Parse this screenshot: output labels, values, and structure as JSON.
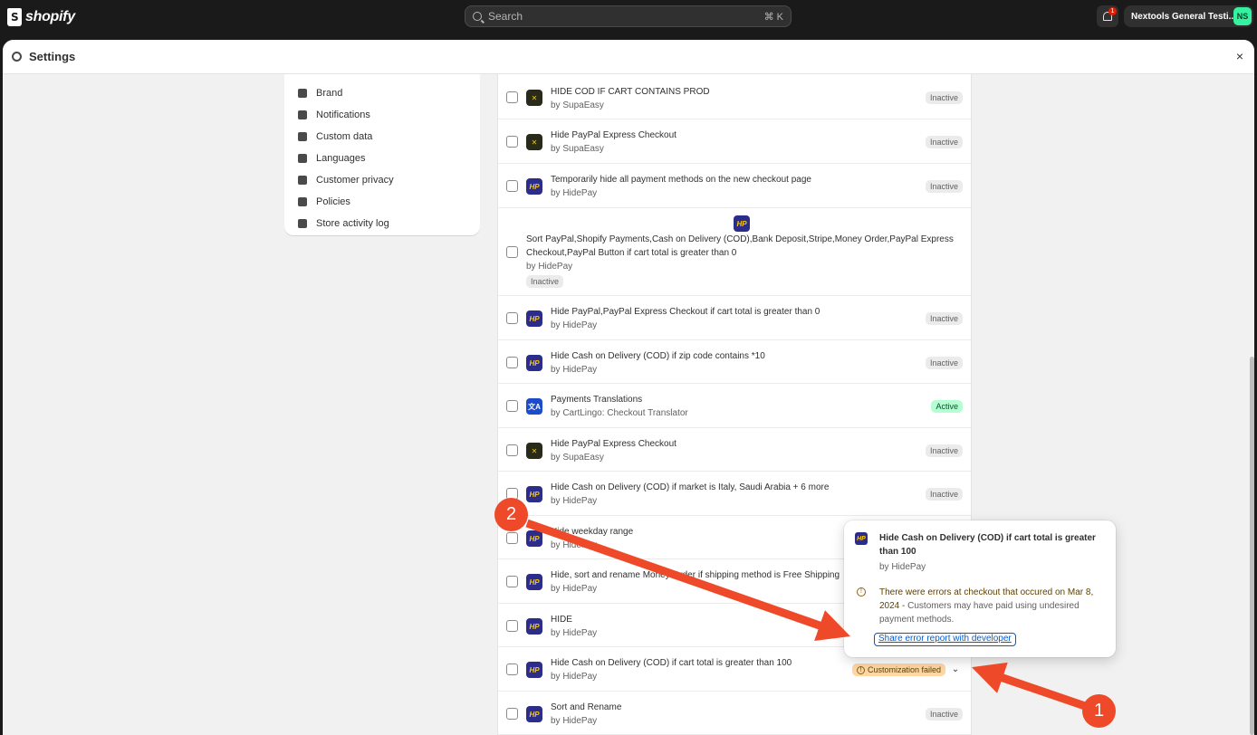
{
  "topbar": {
    "logo_text": "shopify",
    "search_placeholder": "Search",
    "search_shortcut": "⌘ K",
    "notification_count": "1",
    "store_name": "Nextools General Testi...",
    "avatar_initials": "NS"
  },
  "modal": {
    "title": "Settings",
    "close_glyph": "×"
  },
  "sidebar": {
    "items": [
      {
        "label": "Brand",
        "icon": "brand-icon"
      },
      {
        "label": "Notifications",
        "icon": "bell-icon"
      },
      {
        "label": "Custom data",
        "icon": "custom-data-icon"
      },
      {
        "label": "Languages",
        "icon": "language-icon"
      },
      {
        "label": "Customer privacy",
        "icon": "lock-icon"
      },
      {
        "label": "Policies",
        "icon": "policies-icon"
      },
      {
        "label": "Store activity log",
        "icon": "activity-log-icon"
      }
    ]
  },
  "rows": [
    {
      "title": "HIDE COD IF CART CONTAINS PROD",
      "by": "by SupaEasy",
      "icon": "supaeasy",
      "status": "Inactive"
    },
    {
      "title": "Hide PayPal Express Checkout",
      "by": "by SupaEasy",
      "icon": "supaeasy",
      "status": "Inactive"
    },
    {
      "title": "Temporarily hide all payment methods on the new checkout page",
      "by": "by HidePay",
      "icon": "hidepay",
      "status": "Inactive"
    },
    {
      "title_line1": "Sort PayPal,Shopify Payments,Cash on Delivery (COD),Bank Deposit,Stripe,Money Order,PayPal Express",
      "title_line2": "Checkout,PayPal Button if cart total is greater than 0",
      "by": "by HidePay",
      "icon": "hidepay",
      "status": "Inactive"
    },
    {
      "title": "Hide PayPal,PayPal Express Checkout if cart total is greater than 0",
      "by": "by HidePay",
      "icon": "hidepay",
      "status": "Inactive"
    },
    {
      "title": "Hide Cash on Delivery (COD) if zip code contains *10",
      "by": "by HidePay",
      "icon": "hidepay",
      "status": "Inactive"
    },
    {
      "title": "Payments Translations",
      "by": "by CartLingo: Checkout Translator",
      "icon": "cartlingo",
      "status": "Active"
    },
    {
      "title": "Hide PayPal Express Checkout",
      "by": "by SupaEasy",
      "icon": "supaeasy",
      "status": "Inactive"
    },
    {
      "title": "Hide Cash on Delivery (COD) if market is Italy, Saudi Arabia + 6 more",
      "by": "by HidePay",
      "icon": "hidepay",
      "status": "Inactive"
    },
    {
      "title": "Hide weekday range",
      "by": "by HidePay",
      "icon": "hidepay",
      "status": ""
    },
    {
      "title": "Hide, sort and rename Money Order if shipping method is Free Shipping",
      "by": "by HidePay",
      "icon": "hidepay",
      "status": ""
    },
    {
      "title": "HIDE",
      "by": "by HidePay",
      "icon": "hidepay",
      "status": ""
    },
    {
      "title": "Hide Cash on Delivery (COD) if cart total is greater than 100",
      "by": "by HidePay",
      "icon": "hidepay",
      "status": "Customization failed"
    },
    {
      "title": "Sort and Rename",
      "by": "by HidePay",
      "icon": "hidepay",
      "status": "Inactive"
    }
  ],
  "popover": {
    "title": "Hide Cash on Delivery (COD) if cart total is greater than 100",
    "by": "by HidePay",
    "warning_strong": "There were errors at checkout that occured on Mar 8, 2024 -",
    "warning_rest": " Customers may have paid using undesired payment methods.",
    "link": "Share error report with developer"
  },
  "annotations": {
    "marker_1": "1",
    "marker_2": "2",
    "arrow_color": "#ee4a2a"
  },
  "colors": {
    "topbar_bg": "#1a1a1a",
    "hidepay_icon": "#2c2c8a",
    "active_badge": "#b4fed2",
    "failed_badge": "#ffd6a4",
    "link": "#005bd3"
  }
}
